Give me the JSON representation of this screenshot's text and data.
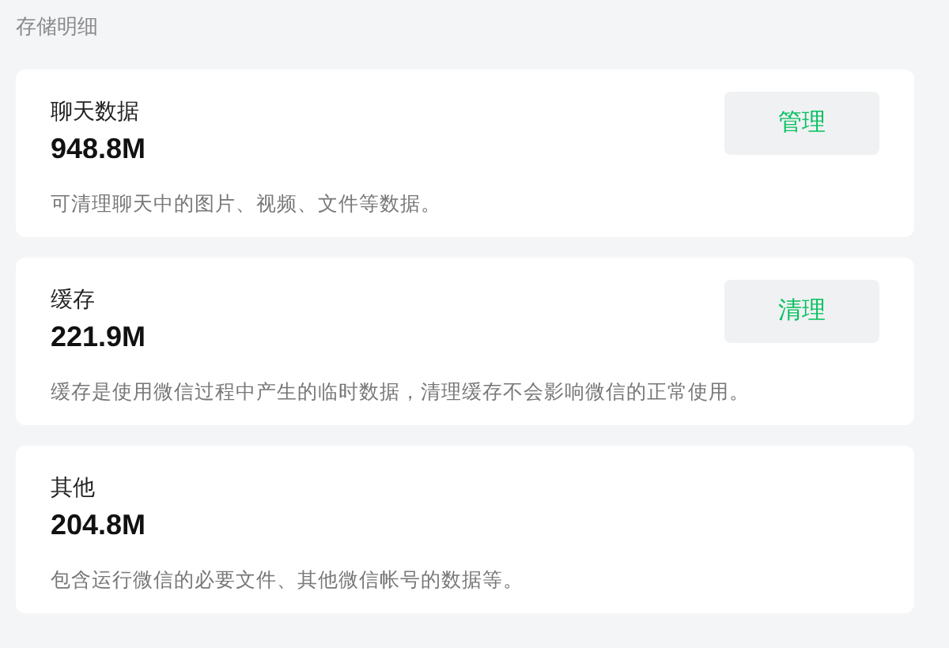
{
  "section_title": "存储明细",
  "items": [
    {
      "title": "聊天数据",
      "size": "948.8M",
      "description": "可清理聊天中的图片、视频、文件等数据。",
      "button": "管理"
    },
    {
      "title": "缓存",
      "size": "221.9M",
      "description": "缓存是使用微信过程中产生的临时数据，清理缓存不会影响微信的正常使用。",
      "button": "清理"
    },
    {
      "title": "其他",
      "size": "204.8M",
      "description": "包含运行微信的必要文件、其他微信帐号的数据等。"
    }
  ]
}
